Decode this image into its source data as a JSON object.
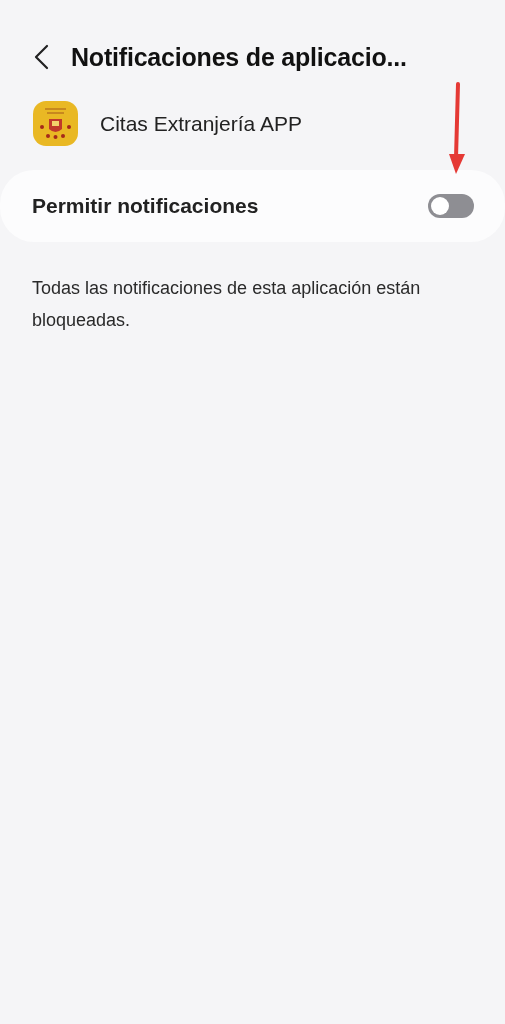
{
  "header": {
    "title": "Notificaciones de aplicacio..."
  },
  "app": {
    "name": "Citas Extranjería APP"
  },
  "setting": {
    "label": "Permitir notificaciones",
    "on": false
  },
  "description": "Todas las notificaciones de esta aplicación están bloqueadas."
}
